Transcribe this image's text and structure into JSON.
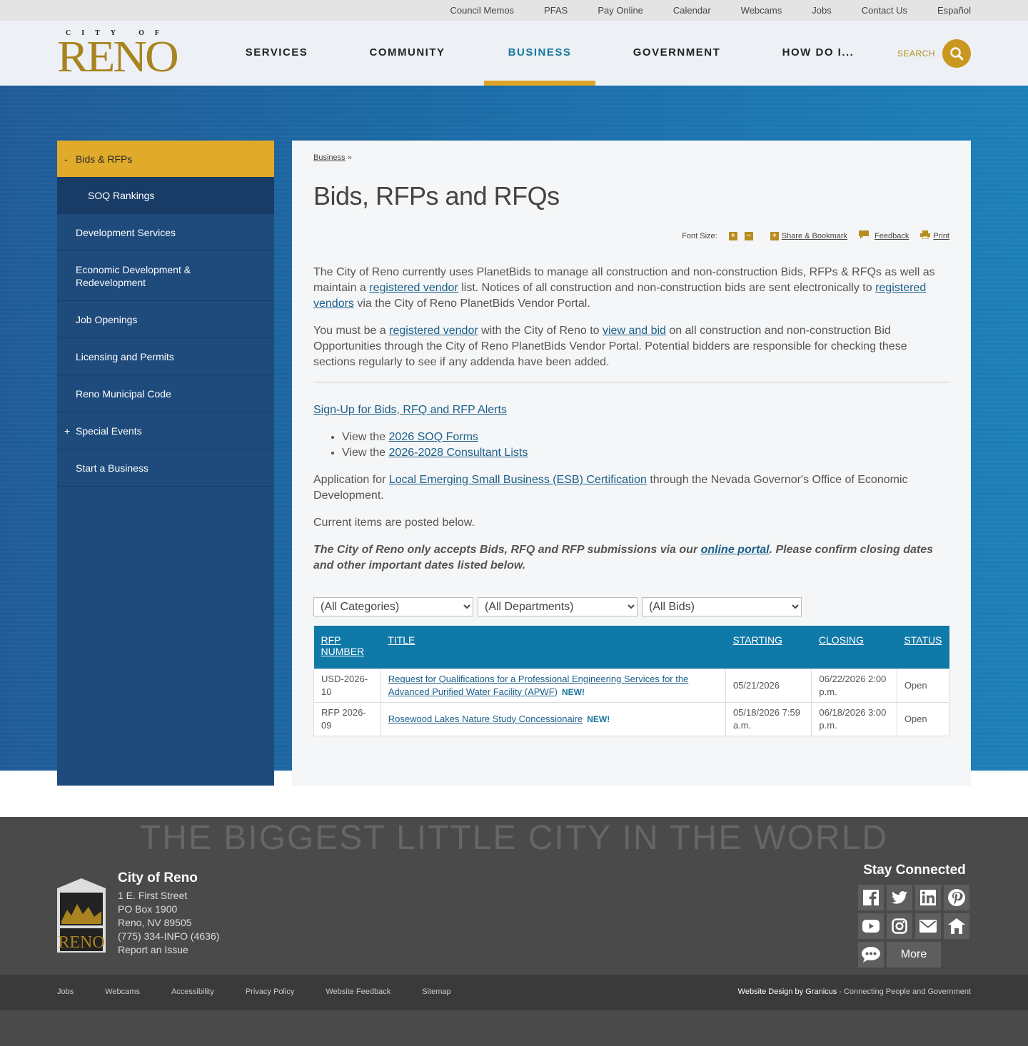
{
  "utility_nav": [
    "Council Memos",
    "PFAS",
    "Pay Online",
    "Calendar",
    "Webcams",
    "Jobs",
    "Contact Us",
    "Español"
  ],
  "logo": {
    "city_of": "CITY OF",
    "name": "RENO"
  },
  "main_nav": [
    {
      "label": "SERVICES"
    },
    {
      "label": "COMMUNITY"
    },
    {
      "label": "BUSINESS",
      "active": true
    },
    {
      "label": "GOVERNMENT"
    },
    {
      "label": "HOW DO I..."
    }
  ],
  "search": {
    "label": "SEARCH",
    "icon": "search-icon"
  },
  "sidebar": {
    "items": [
      {
        "label": "Bids & RFPs",
        "toggle": "-",
        "active": true
      },
      {
        "label": "SOQ Rankings",
        "sub": true
      },
      {
        "label": "Development Services"
      },
      {
        "label": "Economic Development & Redevelopment"
      },
      {
        "label": "Job Openings"
      },
      {
        "label": "Licensing and Permits"
      },
      {
        "label": "Reno Municipal Code"
      },
      {
        "label": "Special Events",
        "toggle": "+"
      },
      {
        "label": "Start a Business"
      }
    ]
  },
  "breadcrumb": {
    "link": "Business",
    "sep": "»"
  },
  "page_title": "Bids, RFPs and RFQs",
  "tools": {
    "font_size": "Font Size:",
    "increase": "+",
    "decrease": "−",
    "share": "Share & Bookmark",
    "feedback": "Feedback",
    "print": "Print"
  },
  "body": {
    "p1_a": "The City of Reno currently uses PlanetBids to manage all construction and non-construction Bids, RFPs & RFQs as well as maintain a ",
    "p1_link1": "registered vendor",
    "p1_b": " list. Notices of all construction and non-construction bids are sent electronically to ",
    "p1_link2": "registered vendors",
    "p1_c": " via the City of Reno PlanetBids Vendor Portal.",
    "p2_a": "You must be a ",
    "p2_link1": "registered vendor",
    "p2_b": " with the City of Reno to ",
    "p2_link2": "view and bid",
    "p2_c": " on all construction and non-construction Bid Opportunities through the City of Reno PlanetBids Vendor Portal. Potential bidders are responsible for checking these sections regularly to see if any addenda have been added.",
    "signup": "Sign-Up for Bids, RFQ and RFP Alerts",
    "li1_a": "View the ",
    "li1_link": "2026 SOQ Forms",
    "li2_a": "View the ",
    "li2_link": "2026-2028 Consultant Lists",
    "p3_a": "Application for ",
    "p3_link": "Local Emerging Small Business (ESB) Certification",
    "p3_b": " through the Nevada Governor's Office of Economic Development.",
    "p4": "Current items are posted below.",
    "note_a": "The City of Reno only accepts Bids, RFQ and RFP submissions via our ",
    "note_link": "online portal",
    "note_b": ".  Please confirm closing dates and other important dates listed below."
  },
  "filters": {
    "category": "(All Categories)",
    "department": "(All Departments)",
    "bids": "(All Bids)"
  },
  "table": {
    "headers": {
      "rfp": "RFP NUMBER",
      "title": "TITLE",
      "starting": "STARTING",
      "closing": "CLOSING",
      "status": "STATUS"
    },
    "rows": [
      {
        "rfp": "USD-2026-10",
        "title": "Request for Qualifications for a Professional Engineering Services for the Advanced Purified Water Facility (APWF)",
        "badge": "NEW!",
        "starting": "05/21/2026",
        "closing": "06/22/2026 2:00 p.m.",
        "status": "Open"
      },
      {
        "rfp": "RFP 2026-09",
        "title": "Rosewood Lakes Nature Study Concessionaire",
        "badge": "NEW!",
        "starting": "05/18/2026 7:59 a.m.",
        "closing": "06/18/2026 3:00 p.m.",
        "status": "Open"
      }
    ]
  },
  "footer": {
    "tagline": "THE BIGGEST LITTLE CITY IN THE WORLD",
    "org": "City of Reno",
    "address1": "1 E. First Street",
    "address2": "PO Box 1900",
    "address3": "Reno, NV 89505",
    "phone": "(775) 334-INFO (4636)",
    "report": "Report an Issue",
    "stay_connected": "Stay Connected",
    "more": "More",
    "links": [
      "Jobs",
      "Webcams",
      "Accessibility",
      "Privacy Policy",
      "Website Feedback",
      "Sitemap"
    ],
    "credit_bold": "Website Design by Granicus",
    "credit_rest": " - Connecting People and Government"
  }
}
